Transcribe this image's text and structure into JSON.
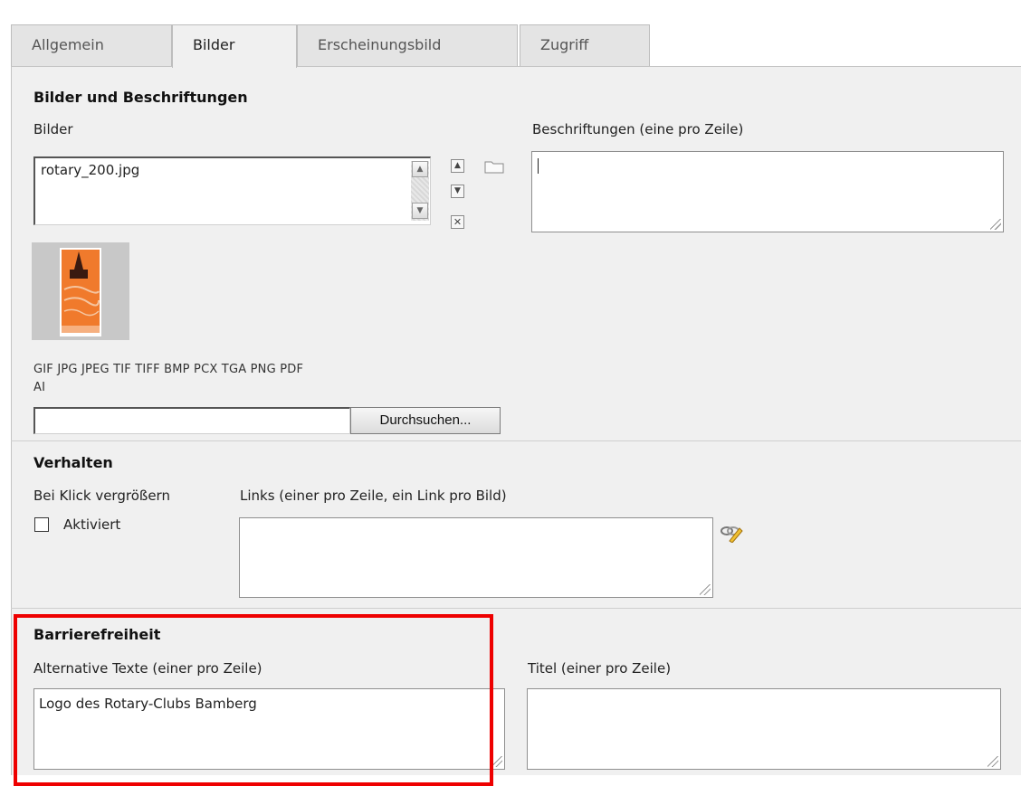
{
  "tabs": [
    {
      "label": "Allgemein",
      "active": false
    },
    {
      "label": "Bilder",
      "active": true
    },
    {
      "label": "Erscheinungsbild",
      "active": false
    },
    {
      "label": "Zugriff",
      "active": false
    }
  ],
  "images_section": {
    "title": "Bilder und Beschriftungen",
    "images_label": "Bilder",
    "image_file": "rotary_200.jpg",
    "captions_label": "Beschriftungen (eine pro Zeile)",
    "captions_value": "",
    "formats_line1": "GIF JPG JPEG TIF TIFF BMP PCX TGA PNG PDF",
    "formats_line2": "AI",
    "browse_button": "Durchsuchen...",
    "file_input_value": ""
  },
  "behavior_section": {
    "title": "Verhalten",
    "enlarge_label": "Bei Klick vergrößern",
    "enlarge_checkbox_label": "Aktiviert",
    "enlarge_checked": false,
    "links_label": "Links (einer pro Zeile, ein Link pro Bild)",
    "links_value": ""
  },
  "accessibility_section": {
    "title": "Barrierefreiheit",
    "alt_label": "Alternative Texte (einer pro Zeile)",
    "alt_value": "Logo des Rotary-Clubs Bamberg",
    "title_label": "Titel (einer pro Zeile)",
    "title_value": ""
  },
  "colors": {
    "panel_bg": "#f0f0f0",
    "highlight": "#ee0000",
    "thumbnail_orange": "#f07a2c"
  }
}
